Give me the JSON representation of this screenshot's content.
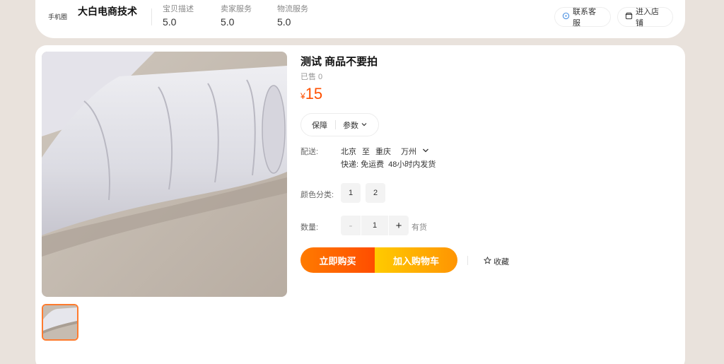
{
  "header": {
    "mobile_link": "手机圈",
    "shop_name": "大白电商技术",
    "scores": [
      {
        "label": "宝贝描述",
        "value": "5.0"
      },
      {
        "label": "卖家服务",
        "value": "5.0"
      },
      {
        "label": "物流服务",
        "value": "5.0"
      }
    ],
    "contact_label": "联系客服",
    "store_label": "进入店铺"
  },
  "product": {
    "title": "测试 商品不要拍",
    "sold": "已售 0",
    "currency": "¥",
    "price": "15",
    "tabs": {
      "guarantee": "保障",
      "params": "参数"
    },
    "shipping": {
      "label": "配送:",
      "from": "北京",
      "to_word": "至",
      "to": "重庆",
      "district": "万州",
      "method": "快递: 免运费",
      "dispatch": "48小时内发货"
    },
    "color": {
      "label": "颜色分类:",
      "options": [
        "1",
        "2"
      ]
    },
    "quantity": {
      "label": "数量:",
      "minus": "-",
      "plus": "+",
      "value": "1",
      "stock": "有货"
    },
    "buy_now": "立即购买",
    "add_cart": "加入购物车",
    "favorite": "收藏"
  },
  "colors": {
    "accent": "#ff5000",
    "buy": "#ff6a00",
    "cart": "#ffb300",
    "thumb_border": "#ff7b2e"
  }
}
